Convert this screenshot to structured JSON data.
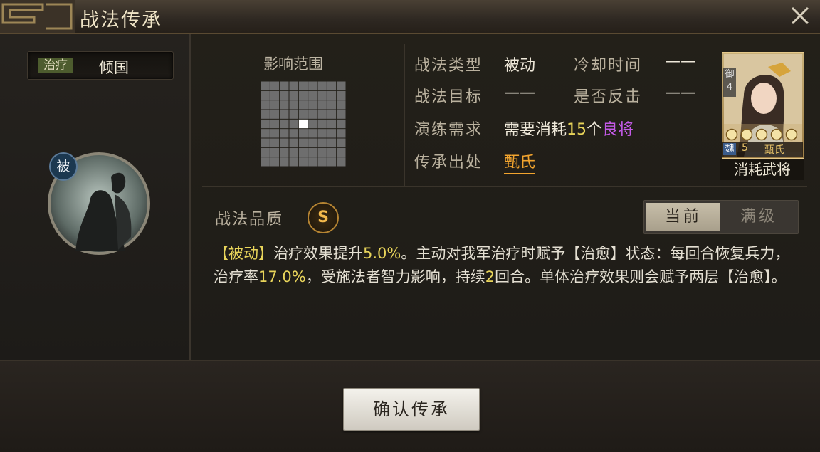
{
  "window": {
    "title": "战法传承"
  },
  "skill": {
    "type_tag": "治疗",
    "name": "倾国",
    "passive_badge": "被",
    "icon": "silhouette-portrait"
  },
  "range": {
    "title": "影响范围"
  },
  "info": {
    "type_label": "战法类型",
    "type_value": "被动",
    "cooldown_label": "冷却时间",
    "cooldown_value": "——",
    "target_label": "战法目标",
    "target_value": "——",
    "counter_label": "是否反击",
    "counter_value": "——",
    "req_label": "演练需求",
    "req_prefix": "需要消耗",
    "req_count": "15",
    "req_unit": "个",
    "req_quality": "良将",
    "source_label": "传承出处",
    "source_value": "甄氏"
  },
  "general_card": {
    "rank": "御4",
    "faction": "魏",
    "level": "5",
    "name": "甄氏",
    "caption": "消耗武将"
  },
  "quality": {
    "label": "战法品质",
    "value": "S"
  },
  "toggle": {
    "current": "当前",
    "max": "满级"
  },
  "description": {
    "p1": "【被动】",
    "p2": "治疗效果提升",
    "v1": "5.0%",
    "p3": "。主动对我军治疗时赋予【治愈】状态：每回合恢复兵力，治疗率",
    "v2": "17.0%",
    "p4": "，受施法者智力影响，持续",
    "v3": "2",
    "p5": "回合。单体治疗效果则会赋予两层【治愈】。"
  },
  "actions": {
    "confirm": "确认传承"
  },
  "colors": {
    "accent": "#e8d45a",
    "source_link": "#f2a42e",
    "quality_purple": "#c45ae8"
  }
}
